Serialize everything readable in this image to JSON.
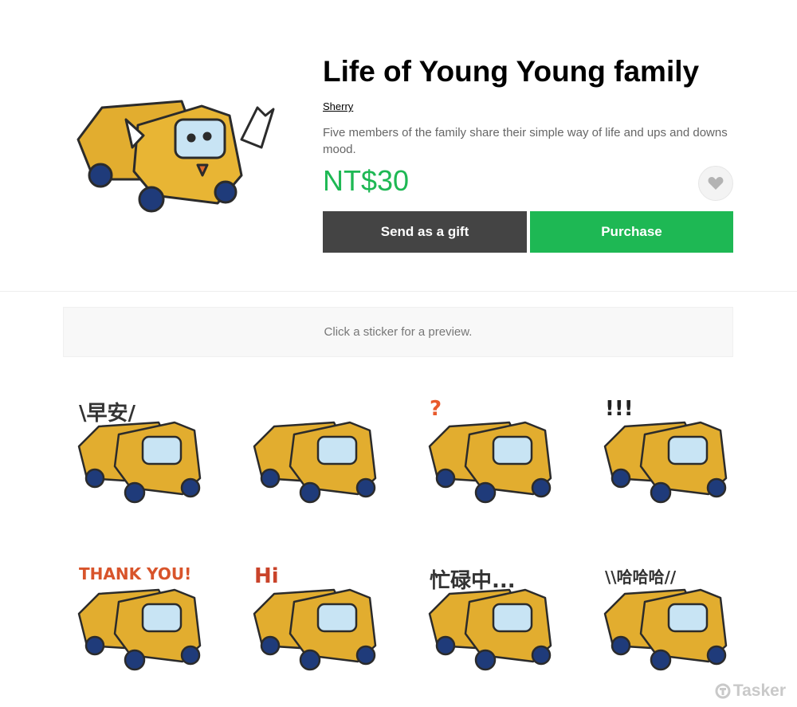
{
  "product": {
    "title": "Life of Young Young family",
    "author": "Sherry",
    "description": "Five members of the family share their simple way of life and ups and downs mood.",
    "price": "NT$30"
  },
  "actions": {
    "gift_label": "Send as a gift",
    "purchase_label": "Purchase",
    "favorite_icon": "heart-icon"
  },
  "preview": {
    "hint": "Click a sticker for a preview."
  },
  "stickers": [
    {
      "name": "sticker-good-morning",
      "caption": "\\早安/"
    },
    {
      "name": "sticker-flowers",
      "caption": ""
    },
    {
      "name": "sticker-question",
      "caption": "?"
    },
    {
      "name": "sticker-exclaim",
      "caption": "!!!"
    },
    {
      "name": "sticker-thank-you",
      "caption": "THANK YOU!"
    },
    {
      "name": "sticker-hi",
      "caption": "Hi"
    },
    {
      "name": "sticker-busy",
      "caption": "忙碌中..."
    },
    {
      "name": "sticker-laugh",
      "caption": "\\\\哈哈哈//"
    }
  ],
  "colors": {
    "accent": "#1eb854",
    "gift_button": "#444444",
    "truck_body": "#e2ad2f",
    "wheel": "#1f3b7a"
  },
  "watermark": "Tasker"
}
